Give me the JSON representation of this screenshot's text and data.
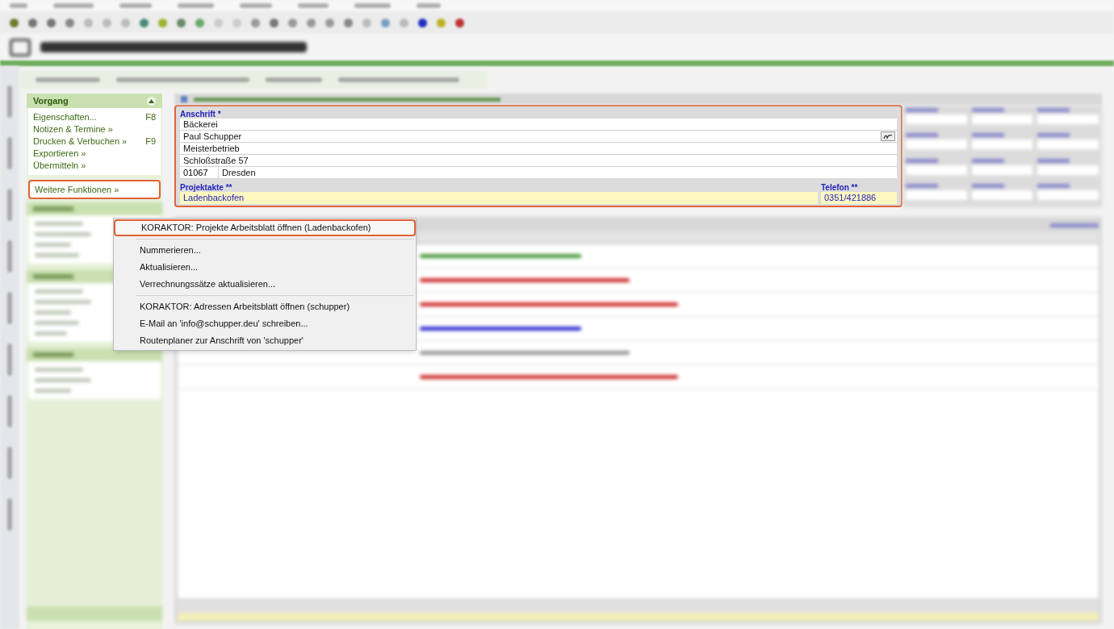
{
  "sidebar": {
    "panel": {
      "title": "Vorgang",
      "expanded": true,
      "items": [
        {
          "label": "Eigenschaften...",
          "shortcut": "F8"
        },
        {
          "label": "Notizen & Termine »"
        },
        {
          "label": "Drucken & Verbuchen »",
          "shortcut": "F9"
        },
        {
          "label": "Exportieren »"
        },
        {
          "label": "Übermitteln »"
        }
      ],
      "more": {
        "label": "Weitere Funktionen »",
        "highlighted": true
      }
    }
  },
  "address_form": {
    "highlighted": true,
    "label": "Anschrift *",
    "lines": [
      "Bäckerei",
      "Paul Schupper",
      "Meisterbetrieb",
      "Schloßstraße 57"
    ],
    "postcode": "01067",
    "city": "Dresden",
    "project_label": "Projektakte **",
    "project": "Ladenbackofen",
    "phone_label": "Telefon **",
    "phone": "0351/421886"
  },
  "context_menu": {
    "items": [
      {
        "kind": "item",
        "label": "KORAKTOR: Projekte Arbeitsblatt öffnen (Ladenbackofen)",
        "highlighted": true
      },
      {
        "kind": "separator"
      },
      {
        "kind": "item",
        "label": "Nummerieren...",
        "highlighted": false
      },
      {
        "kind": "item",
        "label": "Aktualisieren...",
        "highlighted": false
      },
      {
        "kind": "item",
        "label": "Verrechnungssätze aktualisieren...",
        "highlighted": false
      },
      {
        "kind": "separator"
      },
      {
        "kind": "item",
        "label": "KORAKTOR: Adressen Arbeitsblatt öffnen (schupper)",
        "highlighted": false
      },
      {
        "kind": "item",
        "label": "E-Mail an 'info@schupper.deu' schreiben...",
        "highlighted": false
      },
      {
        "kind": "item",
        "label": "Routenplaner zur Anschrift von 'schupper'",
        "highlighted": false
      }
    ]
  }
}
